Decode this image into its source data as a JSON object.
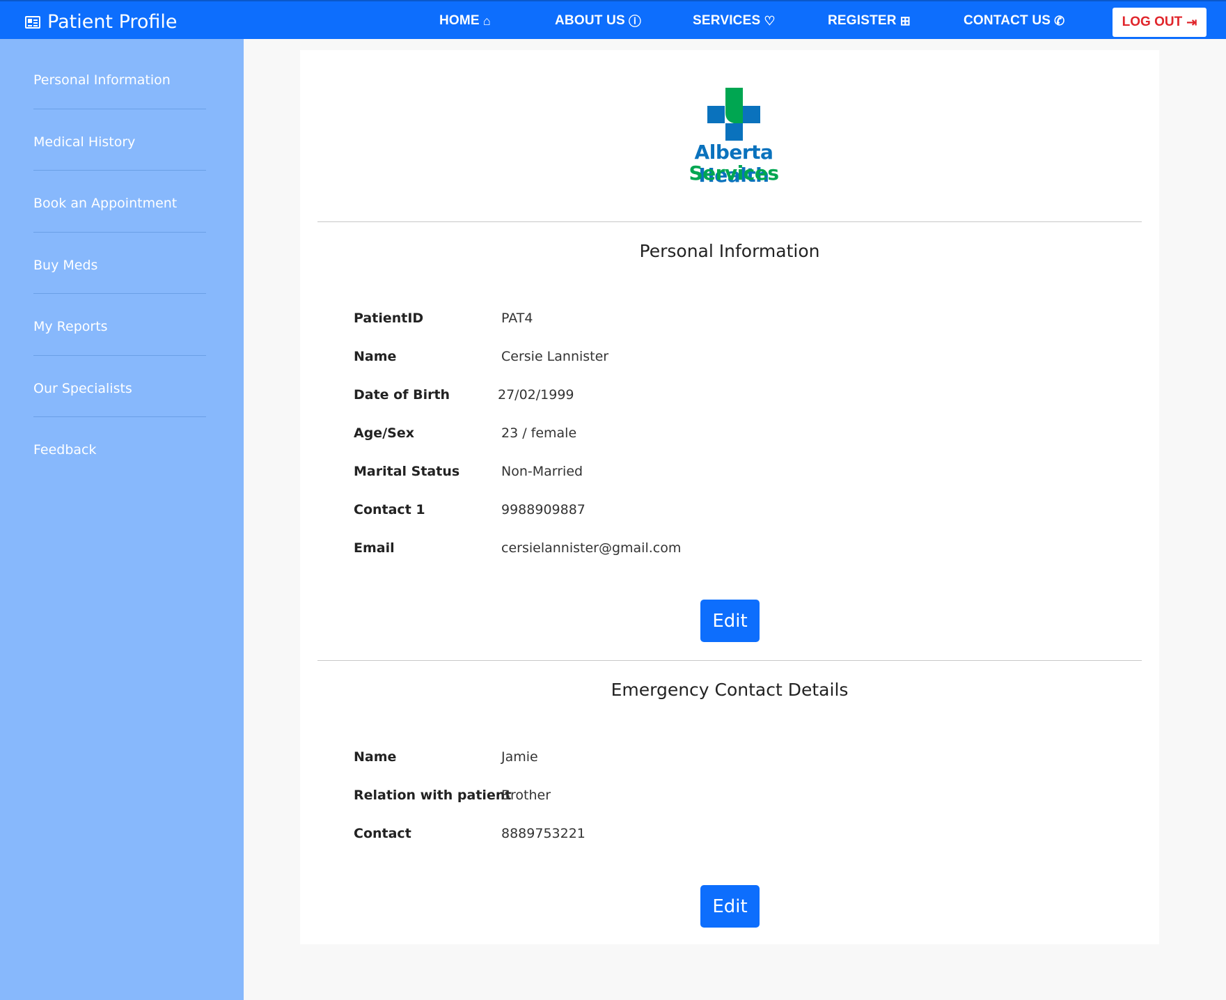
{
  "header": {
    "brand": "Patient Profile",
    "nav": [
      {
        "label": "HOME",
        "glyph": "⌂"
      },
      {
        "label": "ABOUT US",
        "glyph": "ⓘ"
      },
      {
        "label": "SERVICES",
        "glyph": "♡"
      },
      {
        "label": "REGISTER",
        "glyph": "⊞"
      },
      {
        "label": "CONTACT US",
        "glyph": "✆"
      }
    ],
    "logout": {
      "label": "LOG OUT",
      "glyph": "⇥"
    }
  },
  "sidebar": {
    "items": [
      "Personal Information",
      "Medical History",
      "Book an Appointment",
      "Buy Meds",
      "My Reports",
      "Our Specialists",
      "Feedback"
    ]
  },
  "logo": {
    "line1": "Alberta Health",
    "line2": "Services",
    "blue": "#0a72bd",
    "green": "#00a651"
  },
  "personal": {
    "title": "Personal Information",
    "fields": [
      {
        "label": "PatientID",
        "value": "PAT4"
      },
      {
        "label": "Name",
        "value": "Cersie Lannister"
      },
      {
        "label": "Date of Birth",
        "value": "27/02/1999"
      },
      {
        "label": "Age/Sex",
        "value": "23 / female"
      },
      {
        "label": "Marital Status",
        "value": "Non-Married"
      },
      {
        "label": "Contact 1",
        "value": "9988909887"
      },
      {
        "label": "Email",
        "value": "cersielannister@gmail.com"
      }
    ],
    "edit_label": "Edit"
  },
  "emergency": {
    "title": "Emergency Contact Details",
    "fields": [
      {
        "label": "Name",
        "value": "Jamie"
      },
      {
        "label": "Relation with patient",
        "value": "Brother"
      },
      {
        "label": "Contact",
        "value": "8889753221"
      }
    ],
    "edit_label": "Edit"
  },
  "colors": {
    "primary": "#0d6efd",
    "sidebar": "#87b8fc",
    "logout_text": "#e0252b"
  }
}
